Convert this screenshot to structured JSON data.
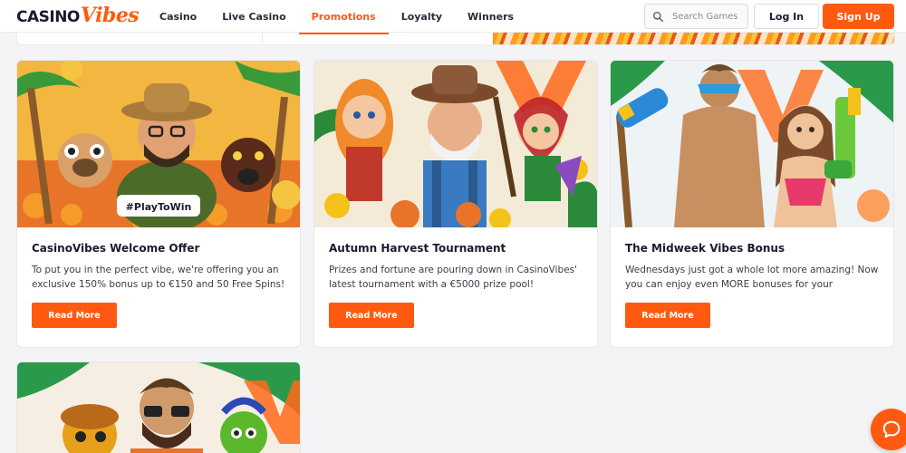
{
  "brand": {
    "logo_casino": "CASINO",
    "logo_vibes": "Vibes",
    "accent": "#ff5a10"
  },
  "nav": {
    "items": [
      {
        "label": "Casino",
        "active": false
      },
      {
        "label": "Live Casino",
        "active": false
      },
      {
        "label": "Promotions",
        "active": true
      },
      {
        "label": "Loyalty",
        "active": false
      },
      {
        "label": "Winners",
        "active": false
      }
    ]
  },
  "search": {
    "placeholder": "Search Games",
    "icon": "search-icon"
  },
  "auth": {
    "login_label": "Log In",
    "signup_label": "Sign Up"
  },
  "promotions": [
    {
      "title": "CasinoVibes Welcome Offer",
      "text": "To put you in the perfect vibe, we're offering you an exclusive 150% bonus up to €150 and 50 Free Spins!",
      "button": "Read More",
      "image_tag": "#PlayToWin"
    },
    {
      "title": "Autumn Harvest Tournament",
      "text": "Prizes and fortune are pouring down in CasinoVibes' latest tournament with a €5000 prize pool!",
      "button": "Read More"
    },
    {
      "title": "The Midweek Vibes Bonus",
      "text": "Wednesdays just got a whole lot more amazing! Now you can enjoy even MORE bonuses for your deposits!",
      "button": "Read More"
    }
  ],
  "chat": {
    "icon": "chat-icon"
  }
}
